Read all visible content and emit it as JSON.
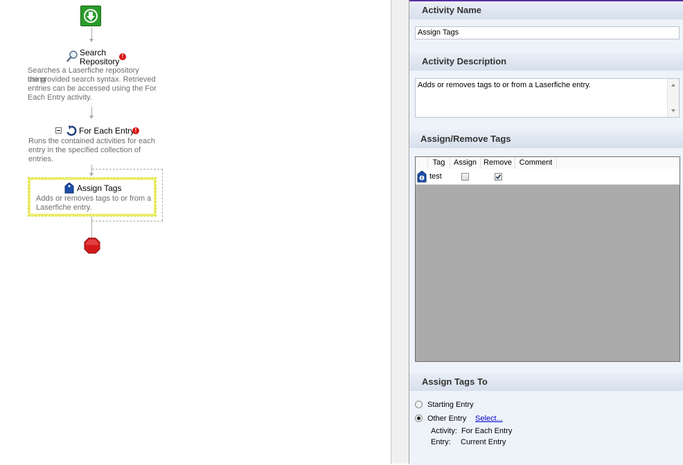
{
  "workflow": {
    "search_title_line1": "Search",
    "search_title_line2": "Repository",
    "search_desc": [
      "Searches a Laserfiche repository using",
      "the provided search syntax.  Retrieved",
      "entries can be accessed using the For",
      "Each Entry activity."
    ],
    "foreach_title": "For Each Entry",
    "foreach_desc": [
      "Runs the contained activities for each",
      "entry in the specified collection of",
      "entries."
    ],
    "assign_title": "Assign Tags",
    "assign_desc": [
      "Adds or removes tags to or from a",
      "Laserfiche entry."
    ],
    "warning_glyph": "!",
    "colors": {
      "start": "#2a9b2a",
      "stop": "#d21a1a",
      "warn": "#d81313",
      "selection": "#ecec6a"
    }
  },
  "panel": {
    "activity_name_header": "Activity Name",
    "activity_name_value": "Assign Tags",
    "activity_description_header": "Activity Description",
    "activity_description_value": "Adds or removes tags to or from a Laserfiche entry.",
    "assign_remove_header": "Assign/Remove Tags",
    "grid": {
      "columns": [
        "Tag",
        "Assign",
        "Remove",
        "Comment"
      ],
      "rows": [
        {
          "tag": "test",
          "assign": false,
          "remove": true,
          "comment": ""
        }
      ]
    },
    "assign_to_header": "Assign Tags To",
    "starting_entry_label": "Starting Entry",
    "other_entry_label": "Other Entry",
    "select_link": "Select...",
    "selected_option": "Other Entry",
    "activity_label": "Activity:",
    "activity_value": "For Each Entry",
    "entry_label": "Entry:",
    "entry_value": "Current Entry",
    "accent_color": "#5a2ea0"
  }
}
